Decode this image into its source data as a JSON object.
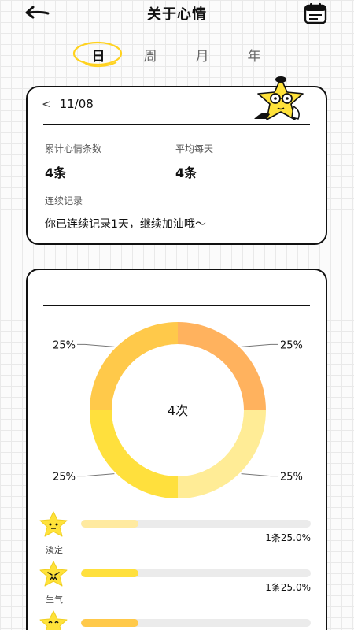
{
  "header": {
    "title": "关于心情",
    "back_icon": "back-arrow-icon",
    "calendar_icon": "calendar-icon"
  },
  "tabs": [
    {
      "label": "日",
      "active": true
    },
    {
      "label": "周",
      "active": false
    },
    {
      "label": "月",
      "active": false
    },
    {
      "label": "年",
      "active": false
    }
  ],
  "summary": {
    "date": "11/08",
    "total_label": "累计心情条数",
    "total_value": "4条",
    "avg_label": "平均每天",
    "avg_value": "4条",
    "streak_label": "连续记录",
    "streak_text": "你已连续记录1天，继续加油哦～"
  },
  "chart_data": {
    "type": "pie",
    "center_label": "4次",
    "slices": [
      {
        "value": 25,
        "label": "25%",
        "color": "#ffb25e"
      },
      {
        "value": 25,
        "label": "25%",
        "color": "#ffec96"
      },
      {
        "value": 25,
        "label": "25%",
        "color": "#ffe03d"
      },
      {
        "value": 25,
        "label": "25%",
        "color": "#ffc94a"
      }
    ]
  },
  "moods": [
    {
      "name": "淡定",
      "face": "calm",
      "fraction": 0.25,
      "text": "1条25.0%",
      "color": "#ffeaa0"
    },
    {
      "name": "生气",
      "face": "angry",
      "fraction": 0.25,
      "text": "1条25.0%",
      "color": "#ffe03d"
    },
    {
      "name": "",
      "face": "happy",
      "fraction": 0.25,
      "text": "",
      "color": "#ffc94a"
    }
  ],
  "colors": {
    "star": "#ffe23a",
    "accent_ring": "#ffd21f"
  }
}
